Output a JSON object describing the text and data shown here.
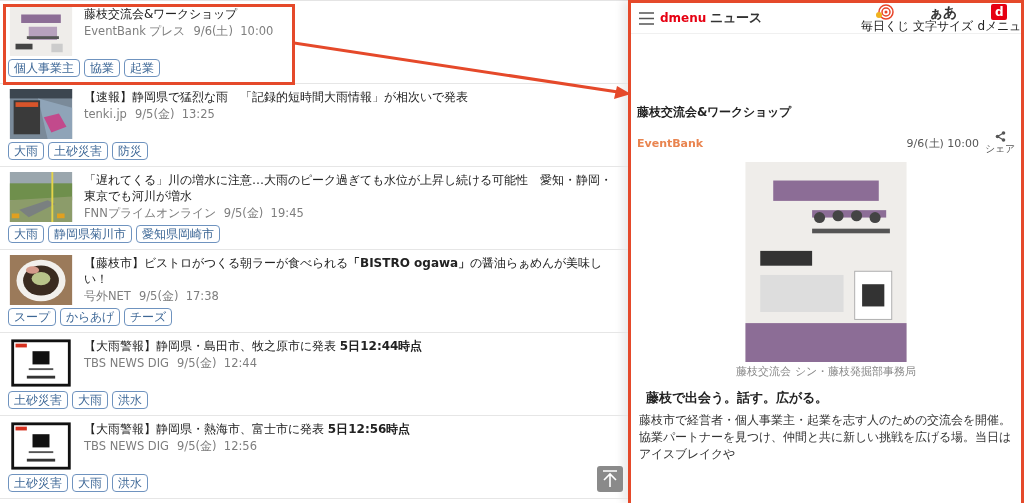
{
  "news_list": {
    "items": [
      {
        "title": "藤枝交流会&ワークショップ",
        "source": "EventBank プレス",
        "date": "9/6(土)  10:00",
        "tags": [
          "個人事業主",
          "協業",
          "起業"
        ],
        "highlighted": true
      },
      {
        "title": "【速報】静岡県で猛烈な雨　「記録的短時間大雨情報」が相次いで発表",
        "source": "tenki.jp",
        "date": "9/5(金)  13:25",
        "tags": [
          "大雨",
          "土砂災害",
          "防災"
        ],
        "highlighted": false
      },
      {
        "title": "「遅れてくる」川の増水に注意…大雨のピーク過ぎても水位が上昇し続ける可能性　愛知・静岡・東京でも河川が増水",
        "source": "FNNプライムオンライン",
        "date": "9/5(金)  19:45",
        "tags": [
          "大雨",
          "静岡県菊川市",
          "愛知県岡崎市"
        ],
        "highlighted": false
      },
      {
        "title": "【藤枝市】ビストロがつくる朝ラーが食べられる**「BISTRO ogawa」**の醤油らぁめんが美味しい！",
        "source": "号外NET",
        "date": "9/5(金)  17:38",
        "tags": [
          "スープ",
          "からあげ",
          "チーズ"
        ],
        "highlighted": false
      },
      {
        "title": "【大雨警報】静岡県・島田市、牧之原市に発表 **5日12:44時点**",
        "source": "TBS NEWS DIG",
        "date": "9/5(金)  12:44",
        "tags": [
          "土砂災害",
          "大雨",
          "洪水"
        ],
        "highlighted": false
      },
      {
        "title": "【大雨警報】静岡県・熱海市、富士市に発表 **5日12:56時点**",
        "source": "TBS NEWS DIG",
        "date": "9/5(金)  12:56",
        "tags": [
          "土砂災害",
          "大雨",
          "洪水"
        ],
        "highlighted": false
      }
    ]
  },
  "article_panel": {
    "header": {
      "logo": "dmenu",
      "title": "ニュース",
      "actions": [
        {
          "kind": "lottery",
          "label": "毎日くじ"
        },
        {
          "kind": "font_size",
          "glyph": "ぁあ",
          "label": "文字サイズ"
        },
        {
          "kind": "dmenu",
          "glyph": "d",
          "label": "dメニュ"
        }
      ]
    },
    "title": "藤枝交流会&ワークショップ",
    "publisher": "EventBank",
    "date": "9/6(土) 10:00",
    "share_label": "シェア",
    "image_caption": "藤枝交流会 シン・藤枝発掘部事務局",
    "heading": "藤枝で出会う。話す。広がる。",
    "body": "藤枝市で経営者・個人事業主・起業を志す人のための交流会を開催。協業パートナーを見つけ、仲間と共に新しい挑戦を広げる場。当日はアイスブレイクや"
  }
}
